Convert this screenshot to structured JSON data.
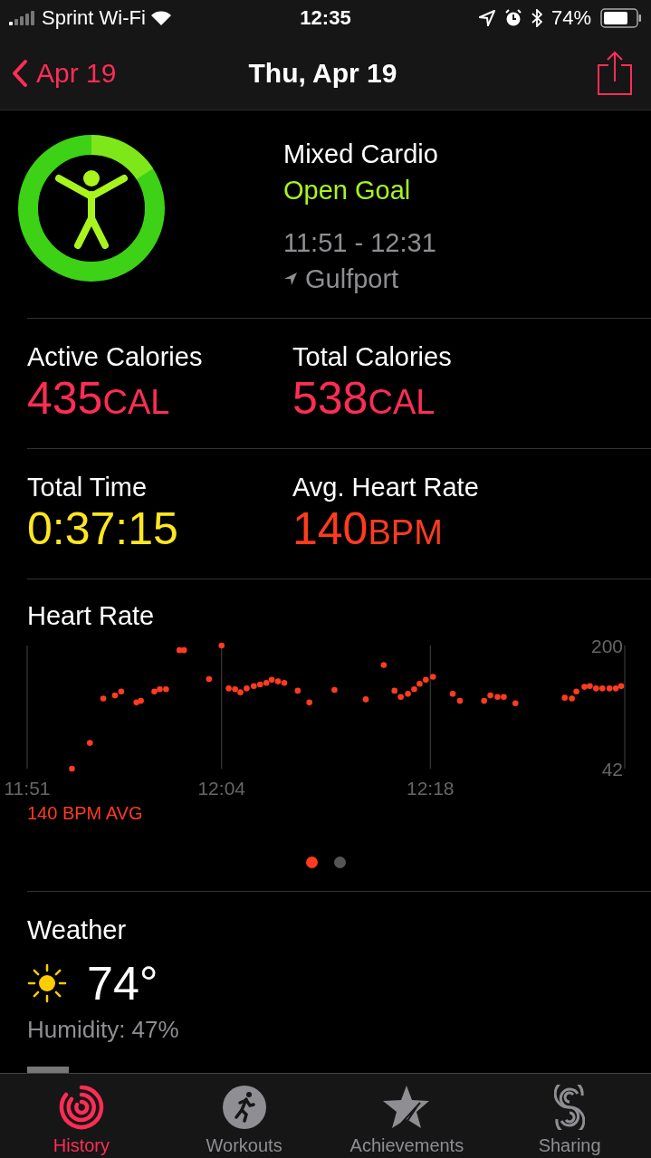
{
  "status_bar": {
    "carrier": "Sprint Wi-Fi",
    "time": "12:35",
    "battery": "74%"
  },
  "nav": {
    "back": "Apr 19",
    "title": "Thu, Apr 19"
  },
  "workout": {
    "name": "Mixed Cardio",
    "goal": "Open Goal",
    "time_range": "11:51 - 12:31",
    "location": "Gulfport"
  },
  "metrics": [
    {
      "label": "Active Calories",
      "value": "435",
      "unit": "CAL",
      "color": "#ff2d55"
    },
    {
      "label": "Total Calories",
      "value": "538",
      "unit": "CAL",
      "color": "#ff2d55"
    },
    {
      "label": "Total Time",
      "value": "0:37:15",
      "color": "#ffe620"
    },
    {
      "label": "Avg. Heart Rate",
      "value": "140",
      "unit": "BPM",
      "color": "#ff3b1f"
    }
  ],
  "heart_rate": {
    "title": "Heart Rate",
    "average": "140 BPM AVG",
    "chart_data": {
      "type": "scatter",
      "xlim": [
        11.85,
        12.517
      ],
      "ylim": [
        42,
        200
      ],
      "xticks": [
        {
          "value": 11.85,
          "label": "11:51"
        },
        {
          "value": 12.067,
          "label": "12:04"
        },
        {
          "value": 12.3,
          "label": "12:18"
        }
      ],
      "yticks": [
        200,
        42
      ],
      "x": [
        11.9,
        11.92,
        11.935,
        11.948,
        11.955,
        11.972,
        11.977,
        11.992,
        11.998,
        12.005,
        12.02,
        12.025,
        12.053,
        12.067,
        12.075,
        12.082,
        12.088,
        12.095,
        12.103,
        12.11,
        12.117,
        12.123,
        12.13,
        12.137,
        12.152,
        12.165,
        12.193,
        12.228,
        12.248,
        12.26,
        12.267,
        12.275,
        12.282,
        12.288,
        12.295,
        12.303,
        12.325,
        12.333,
        12.36,
        12.367,
        12.375,
        12.382,
        12.395,
        12.45,
        12.458,
        12.463,
        12.472,
        12.478,
        12.485,
        12.492,
        12.5,
        12.507,
        12.513
      ],
      "values": [
        42,
        75,
        132,
        136,
        141,
        127,
        129,
        141,
        144,
        144,
        194,
        194,
        157,
        200,
        145,
        144,
        140,
        145,
        148,
        150,
        152,
        156,
        154,
        152,
        142,
        127,
        143,
        131,
        175,
        142,
        134,
        138,
        144,
        151,
        156,
        160,
        138,
        129,
        129,
        136,
        134,
        134,
        126,
        133,
        132,
        141,
        147,
        148,
        145,
        145,
        145,
        145,
        148
      ]
    },
    "pages": [
      {
        "selected": true
      },
      {
        "selected": false
      }
    ]
  },
  "weather": {
    "title": "Weather",
    "temperature": "74°",
    "humidity": "Humidity: 47%"
  },
  "tabs": [
    {
      "label": "History",
      "kind": "history",
      "selected": true
    },
    {
      "label": "Workouts",
      "kind": "workouts",
      "selected": false
    },
    {
      "label": "Achievements",
      "kind": "achievements",
      "selected": false
    },
    {
      "label": "Sharing",
      "kind": "sharing",
      "selected": false
    }
  ]
}
